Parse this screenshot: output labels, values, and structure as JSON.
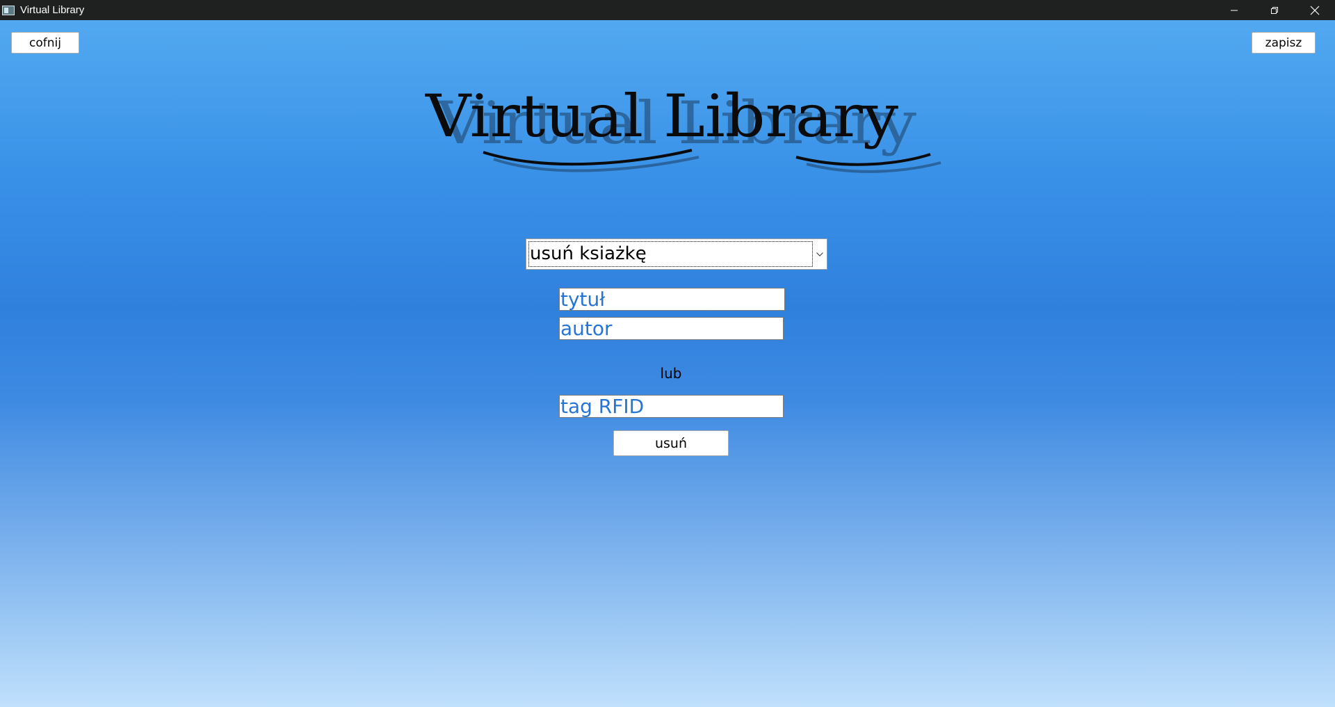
{
  "window": {
    "title": "Virtual Library",
    "controls": [
      "minimize-icon",
      "restore-icon",
      "close-icon"
    ]
  },
  "toolbar": {
    "back_label": "cofnij",
    "save_label": "zapisz"
  },
  "logo": {
    "text": "Virtual Library"
  },
  "action_select": {
    "selected": "usuń ksiażkę"
  },
  "form": {
    "title_placeholder": "tytuł",
    "author_placeholder": "autor",
    "or_label": "lub",
    "rfid_placeholder": "tag RFID",
    "delete_label": "usuń"
  },
  "colors": {
    "background_top": "#52a9f0",
    "background_middle": "#2f80dd",
    "background_bottom": "#c0e0fc",
    "input_text": "#2475d6",
    "titlebar": "#1e211f"
  }
}
